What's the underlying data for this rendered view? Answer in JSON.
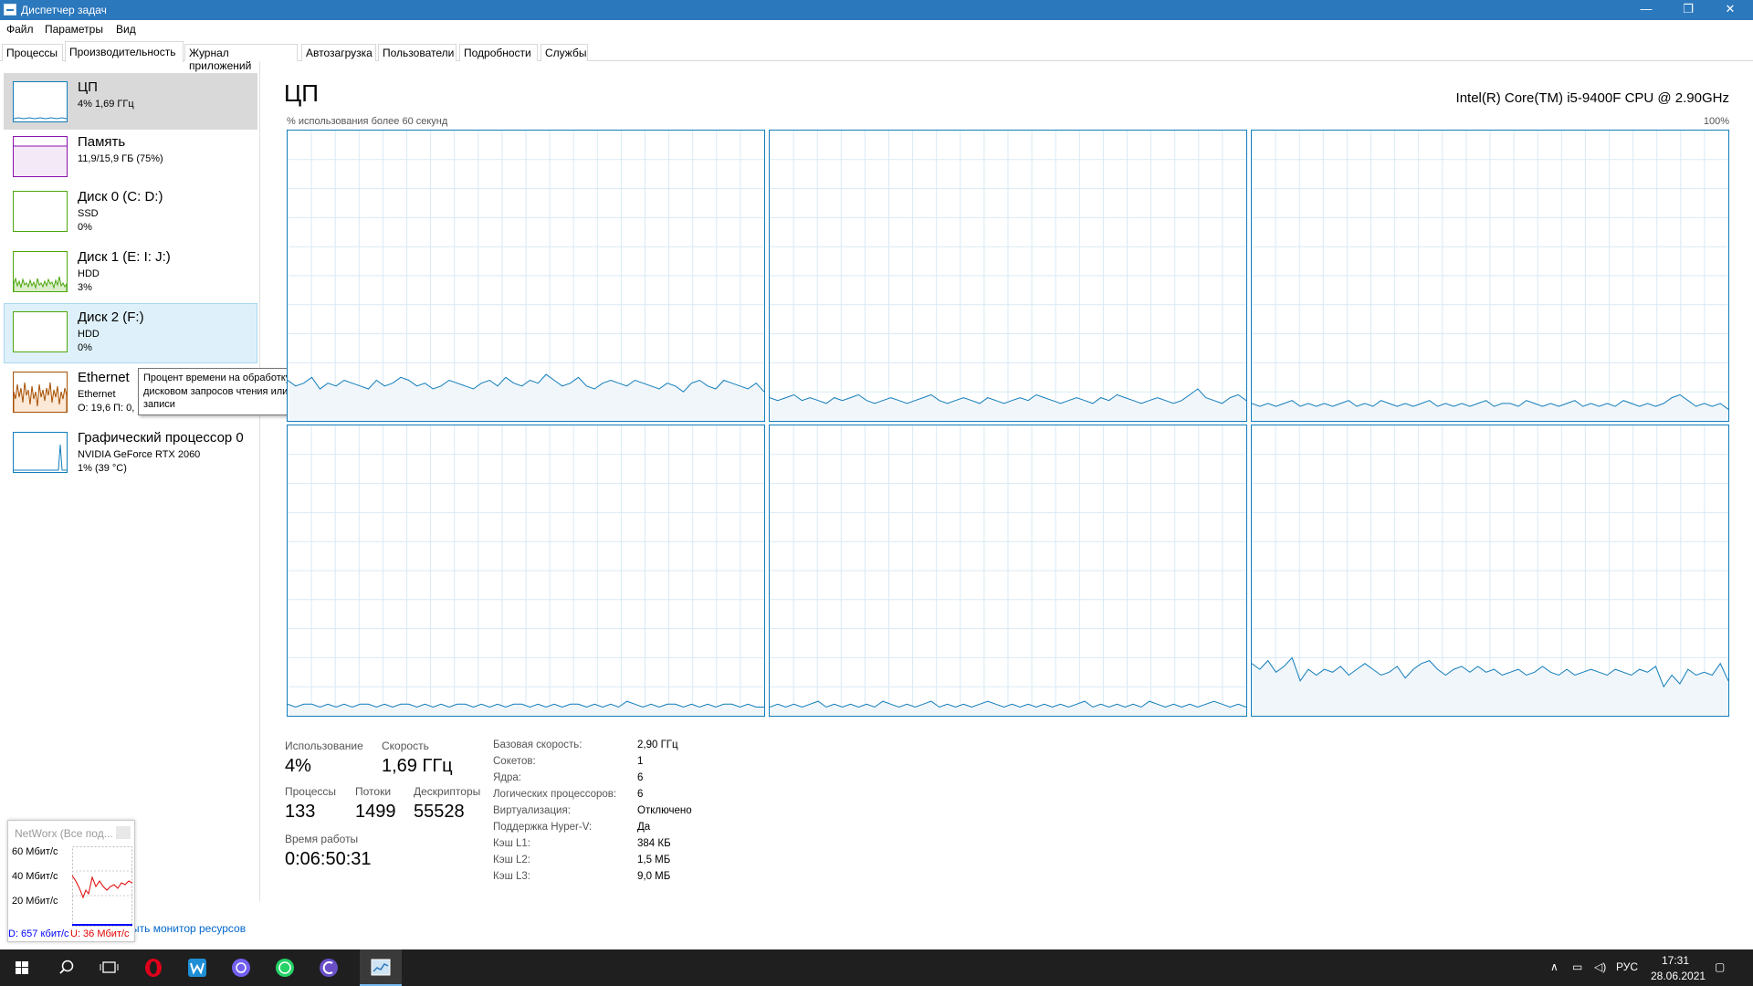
{
  "window": {
    "title": "Диспетчер задач",
    "buttons": {
      "minimize": "—",
      "maximize": "❐",
      "close": "✕"
    }
  },
  "menu": [
    "Файл",
    "Параметры",
    "Вид"
  ],
  "tabs": [
    "Процессы",
    "Производительность",
    "Журнал приложений",
    "Автозагрузка",
    "Пользователи",
    "Подробности",
    "Службы"
  ],
  "active_tab": "Производительность",
  "devices": [
    {
      "name": "ЦП",
      "line2": "4% 1,69 ГГц",
      "line3": "",
      "color": "#117dbb"
    },
    {
      "name": "Память",
      "line2": "11,9/15,9 ГБ (75%)",
      "line3": "",
      "color": "#8b12ae"
    },
    {
      "name": "Диск 0 (C: D:)",
      "line2": "SSD",
      "line3": "0%",
      "color": "#4da60c"
    },
    {
      "name": "Диск 1 (E: I: J:)",
      "line2": "HDD",
      "line3": "3%",
      "color": "#4da60c"
    },
    {
      "name": "Диск 2 (F:)",
      "line2": "HDD",
      "line3": "0%",
      "color": "#4da60c"
    },
    {
      "name": "Ethernet",
      "line2": "Ethernet",
      "line3": "О: 19,6 П: 0,",
      "color": "#a74f01"
    },
    {
      "name": "Графический процессор 0",
      "line2": "NVIDIA GeForce RTX 2060",
      "line3": "1% (39 °C)",
      "color": "#117dbb"
    }
  ],
  "tooltip": "Процент времени на обработку дисковом запросов чтения или записи",
  "main": {
    "title": "ЦП",
    "cpu_model": "Intel(R) Core(TM) i5-9400F CPU @ 2.90GHz",
    "graph_label": "% использования более 60 секунд",
    "graph_max": "100%",
    "graph_color": "#117dbb",
    "grid_color": "#d9eaf4"
  },
  "chart_data": {
    "type": "area",
    "title": "ЦП",
    "ylabel": "% использования более 60 секунд",
    "ylim": [
      0,
      100
    ],
    "series": [
      {
        "values": [
          14,
          12,
          13,
          15,
          11,
          13,
          12,
          14,
          13,
          12,
          11,
          14,
          12,
          13,
          15,
          14,
          12,
          13,
          11,
          12,
          14,
          13,
          12,
          11,
          13,
          14,
          12,
          15,
          13,
          12,
          14,
          13,
          16,
          14,
          12,
          13,
          15,
          12,
          11,
          13,
          14,
          13,
          12,
          14,
          13,
          12,
          11,
          13,
          12,
          10,
          13,
          14,
          12,
          11,
          14,
          13,
          12,
          11,
          13,
          10
        ]
      },
      {
        "values": [
          8,
          7,
          8,
          9,
          7,
          8,
          7,
          6,
          8,
          7,
          8,
          9,
          7,
          6,
          7,
          8,
          7,
          6,
          7,
          8,
          9,
          7,
          6,
          7,
          8,
          7,
          6,
          8,
          7,
          6,
          7,
          8,
          7,
          9,
          8,
          7,
          6,
          7,
          8,
          7,
          6,
          8,
          7,
          9,
          8,
          7,
          6,
          7,
          8,
          7,
          6,
          7,
          9,
          11,
          8,
          7,
          6,
          8,
          9,
          7
        ]
      },
      {
        "values": [
          6,
          5,
          6,
          5,
          6,
          7,
          5,
          6,
          5,
          6,
          5,
          6,
          7,
          5,
          6,
          5,
          7,
          6,
          5,
          6,
          5,
          6,
          7,
          5,
          6,
          5,
          6,
          5,
          6,
          7,
          5,
          6,
          6,
          5,
          7,
          6,
          5,
          6,
          5,
          6,
          7,
          5,
          6,
          5,
          6,
          5,
          7,
          6,
          5,
          6,
          5,
          6,
          8,
          9,
          7,
          5,
          6,
          5,
          6,
          4
        ]
      },
      {
        "values": [
          4,
          3,
          4,
          4,
          3,
          4,
          3,
          4,
          3,
          4,
          4,
          3,
          4,
          3,
          4,
          4,
          3,
          4,
          3,
          4,
          3,
          4,
          4,
          3,
          4,
          3,
          4,
          3,
          4,
          4,
          3,
          4,
          3,
          4,
          3,
          4,
          4,
          3,
          4,
          3,
          4,
          3,
          5,
          4,
          3,
          4,
          3,
          4,
          4,
          3,
          4,
          3,
          4,
          3,
          4,
          4,
          3,
          4,
          3,
          3
        ]
      },
      {
        "values": [
          3,
          4,
          3,
          4,
          3,
          4,
          5,
          3,
          4,
          3,
          4,
          3,
          4,
          3,
          5,
          4,
          3,
          4,
          3,
          4,
          5,
          3,
          4,
          3,
          4,
          3,
          4,
          5,
          4,
          3,
          4,
          3,
          4,
          3,
          4,
          3,
          4,
          3,
          4,
          5,
          3,
          4,
          3,
          4,
          3,
          4,
          3,
          5,
          4,
          3,
          4,
          3,
          4,
          3,
          4,
          5,
          4,
          3,
          4,
          3
        ]
      },
      {
        "values": [
          18,
          16,
          19,
          15,
          17,
          20,
          12,
          16,
          14,
          16,
          15,
          17,
          14,
          16,
          18,
          16,
          14,
          15,
          17,
          13,
          16,
          18,
          19,
          16,
          14,
          16,
          17,
          15,
          17,
          15,
          16,
          14,
          15,
          16,
          14,
          15,
          17,
          15,
          14,
          16,
          14,
          15,
          16,
          15,
          14,
          16,
          15,
          14,
          16,
          15,
          17,
          10,
          14,
          11,
          16,
          14,
          15,
          14,
          18,
          12
        ]
      }
    ]
  },
  "stats": {
    "utilization": {
      "label": "Использование",
      "value": "4%"
    },
    "speed": {
      "label": "Скорость",
      "value": "1,69 ГГц"
    },
    "processes": {
      "label": "Процессы",
      "value": "133"
    },
    "threads": {
      "label": "Потоки",
      "value": "1499"
    },
    "handles": {
      "label": "Дескрипторы",
      "value": "55528"
    },
    "uptime": {
      "label": "Время работы",
      "value": "0:06:50:31"
    }
  },
  "props": [
    {
      "k": "Базовая скорость:",
      "v": "2,90 ГГц"
    },
    {
      "k": "Сокетов:",
      "v": "1"
    },
    {
      "k": "Ядра:",
      "v": "6"
    },
    {
      "k": "Логических процессоров:",
      "v": "6"
    },
    {
      "k": "Виртуализация:",
      "v": "Отключено"
    },
    {
      "k": "Поддержка Hyper-V:",
      "v": "Да"
    },
    {
      "k": "Кэш L1:",
      "v": "384 КБ"
    },
    {
      "k": "Кэш L2:",
      "v": "1,5 МБ"
    },
    {
      "k": "Кэш L3:",
      "v": "9,0 МБ"
    }
  ],
  "resmon_link": "ыть монитор ресурсов",
  "networx": {
    "title": "NetWorx (Все под...",
    "axis": [
      "60 Мбит/с",
      "40 Мбит/с",
      "20 Мбит/с"
    ],
    "download": "D: 657 кбит/с",
    "upload": "U: 36 Мбит/с"
  },
  "taskbar": {
    "apps": [
      "windows-start-icon",
      "search-icon",
      "task-view-icon",
      "opera-icon",
      "app-w-icon",
      "viber-icon",
      "whatsapp-icon",
      "app-c-icon",
      "task-manager-icon"
    ],
    "lang": "РУС",
    "time": "17:31",
    "date": "28.06.2021"
  }
}
